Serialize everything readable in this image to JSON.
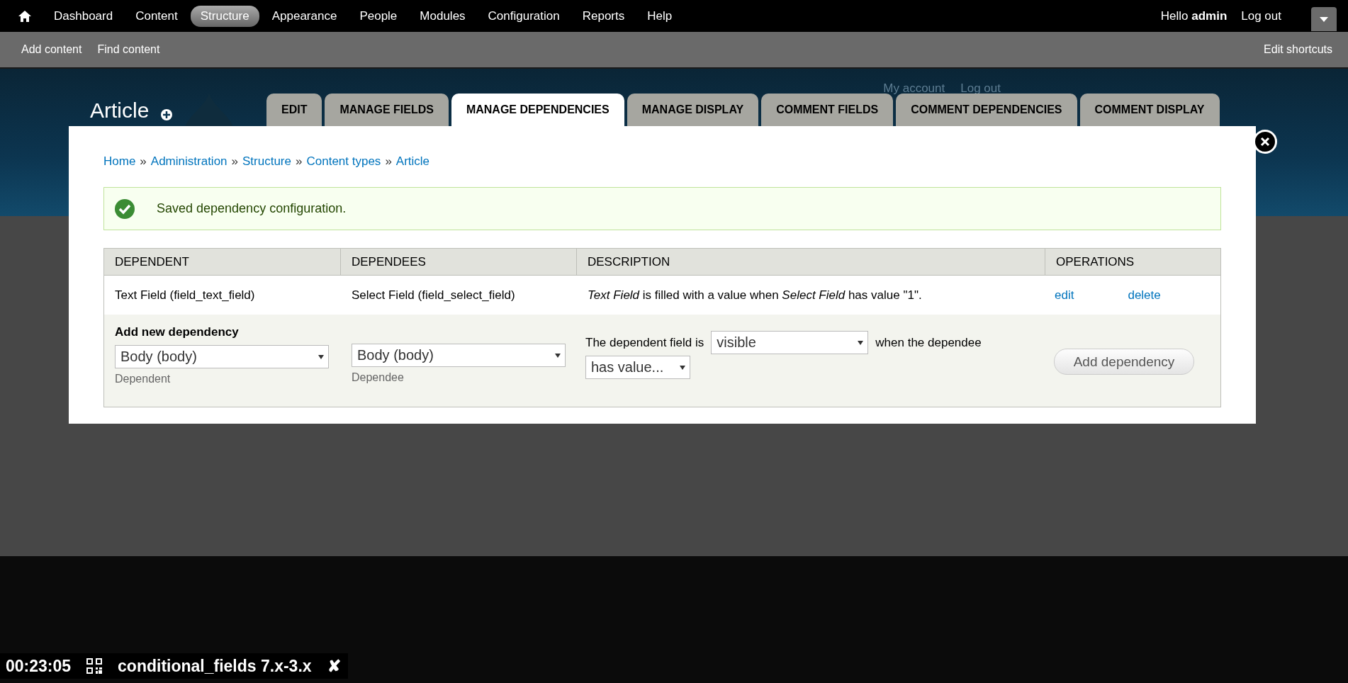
{
  "toolbar": {
    "menu": [
      {
        "label": "Dashboard",
        "selected": false
      },
      {
        "label": "Content",
        "selected": false
      },
      {
        "label": "Structure",
        "selected": true
      },
      {
        "label": "Appearance",
        "selected": false
      },
      {
        "label": "People",
        "selected": false
      },
      {
        "label": "Modules",
        "selected": false
      },
      {
        "label": "Configuration",
        "selected": false
      },
      {
        "label": "Reports",
        "selected": false
      },
      {
        "label": "Help",
        "selected": false
      }
    ],
    "greeting": "Hello",
    "user": "admin",
    "logout": "Log out"
  },
  "shortcuts": {
    "items": [
      "Add content",
      "Find content"
    ],
    "edit": "Edit shortcuts"
  },
  "header": {
    "title": "Article",
    "secondary_links": [
      "My account",
      "Log out"
    ]
  },
  "tabs": [
    {
      "label": "EDIT",
      "selected": false
    },
    {
      "label": "MANAGE FIELDS",
      "selected": false
    },
    {
      "label": "MANAGE DEPENDENCIES",
      "selected": true
    },
    {
      "label": "MANAGE DISPLAY",
      "selected": false
    },
    {
      "label": "COMMENT FIELDS",
      "selected": false
    },
    {
      "label": "COMMENT DEPENDENCIES",
      "selected": false
    },
    {
      "label": "COMMENT DISPLAY",
      "selected": false
    }
  ],
  "breadcrumb": {
    "separator": "»",
    "items": [
      "Home",
      "Administration",
      "Structure",
      "Content types",
      "Article"
    ]
  },
  "message": {
    "kind": "status",
    "text": "Saved dependency configuration."
  },
  "table": {
    "columns": [
      "DEPENDENT",
      "DEPENDEES",
      "DESCRIPTION",
      "OPERATIONS"
    ],
    "rows": [
      {
        "dependent": "Text Field (field_text_field)",
        "dependees": "Select Field (field_select_field)",
        "description": "*Text Field* is filled with a value when *Select Field* has value \"1\".",
        "operations": [
          "edit",
          "delete"
        ]
      }
    ]
  },
  "add_form": {
    "title": "Add new dependency",
    "dependent": {
      "value": "Body (body)",
      "description": "Dependent"
    },
    "dependee": {
      "value": "Body (body)",
      "description": "Dependee"
    },
    "prefix": "The dependent field is",
    "state": "visible",
    "middle": "when the dependee",
    "condition": "has value...",
    "button": "Add dependency"
  },
  "status_bar": {
    "timer": "00:23:05",
    "title": "conditional_fields 7.x-3.x",
    "close": "✘"
  }
}
